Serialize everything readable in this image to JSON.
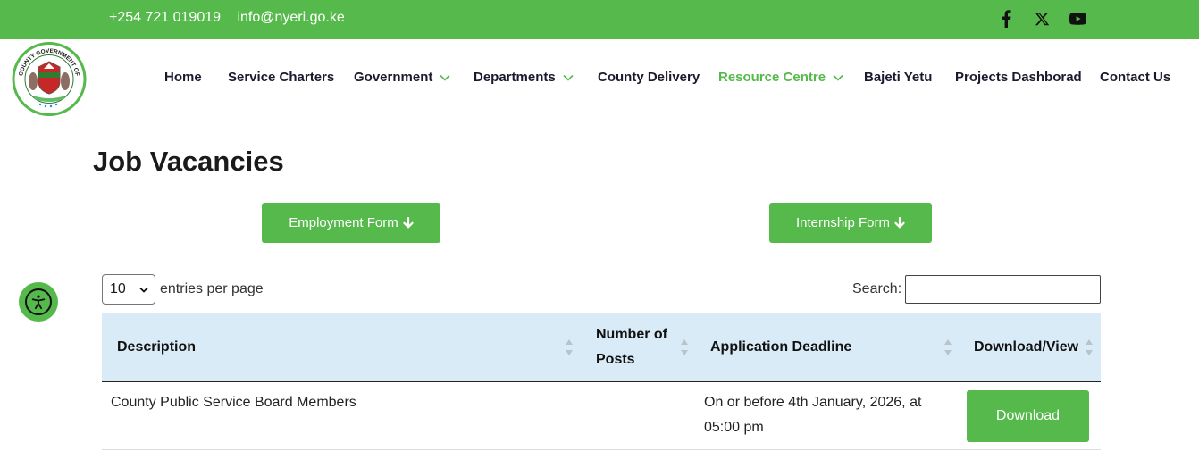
{
  "topbar": {
    "phone": "+254 721 019019",
    "email": "info@nyeri.go.ke",
    "social_icons": [
      "facebook-icon",
      "x-icon",
      "youtube-icon"
    ]
  },
  "brand": {
    "logo_icon": "county-government-of-nyeri-seal-icon",
    "logo_text": "COUNTY GOVERNMENT OF NYERI"
  },
  "nav": {
    "items": [
      {
        "label": "Home"
      },
      {
        "label": "Service Charters"
      },
      {
        "label": "Government"
      },
      {
        "label": "Departments"
      },
      {
        "label": "County Delivery"
      },
      {
        "label": "Resource Centre"
      },
      {
        "label": "Bajeti Yetu"
      },
      {
        "label": "Projects Dashborad"
      },
      {
        "label": "Contact Us"
      }
    ]
  },
  "page": {
    "title": "Job Vacancies",
    "employment_form_label": "Employment Form",
    "internship_form_label": "Internship Form"
  },
  "table_controls": {
    "entries_value": "10",
    "entries_label": "entries per page",
    "search_label": "Search:",
    "search_value": ""
  },
  "table": {
    "headers": {
      "description": "Description",
      "posts_line1": "Number of",
      "posts_line2": "Posts",
      "deadline": "Application Deadline",
      "download": "Download/View"
    },
    "rows": [
      {
        "description": "County Public Service Board Members",
        "posts": "",
        "deadline_line1": "On or before 4th January, 2026, at",
        "deadline_line2": "05:00 pm",
        "download_label": "Download"
      }
    ]
  },
  "colors": {
    "brand_green": "#56b94b",
    "table_header_bg": "#d9ebf6"
  }
}
